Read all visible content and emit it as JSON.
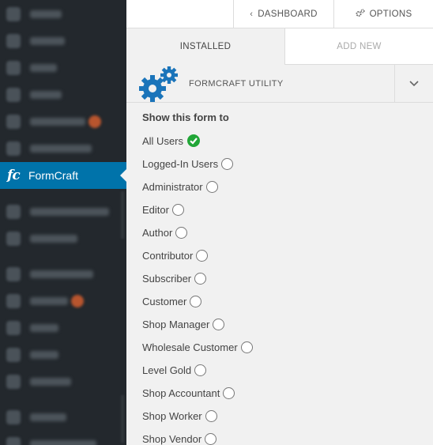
{
  "sidebar": {
    "active_item": {
      "logo": "fc",
      "label": "FormCraft"
    }
  },
  "topbar": {
    "dashboard_label": "DASHBOARD",
    "options_label": "OPTIONS"
  },
  "tabs": [
    {
      "label": "INSTALLED",
      "selected": true
    },
    {
      "label": "ADD NEW",
      "selected": false
    }
  ],
  "addon": {
    "title": "FORMCRAFT UTILITY",
    "icon": "gears-icon",
    "toggle_icon": "chevron-down-icon"
  },
  "visibility": {
    "title": "Show this form to",
    "options": [
      {
        "label": "All Users",
        "checked": true
      },
      {
        "label": "Logged-In Users",
        "checked": false
      },
      {
        "label": "Administrator",
        "checked": false
      },
      {
        "label": "Editor",
        "checked": false
      },
      {
        "label": "Author",
        "checked": false
      },
      {
        "label": "Contributor",
        "checked": false
      },
      {
        "label": "Subscriber",
        "checked": false
      },
      {
        "label": "Customer",
        "checked": false
      },
      {
        "label": "Shop Manager",
        "checked": false
      },
      {
        "label": "Wholesale Customer",
        "checked": false
      },
      {
        "label": "Level Gold",
        "checked": false
      },
      {
        "label": "Shop Accountant",
        "checked": false
      },
      {
        "label": "Shop Worker",
        "checked": false
      },
      {
        "label": "Shop Vendor",
        "checked": false
      }
    ]
  },
  "colors": {
    "sidebar_bg": "#23282d",
    "active_bg": "#0073aa",
    "gear_blue": "#1a74ba",
    "check_green": "#21a637"
  }
}
